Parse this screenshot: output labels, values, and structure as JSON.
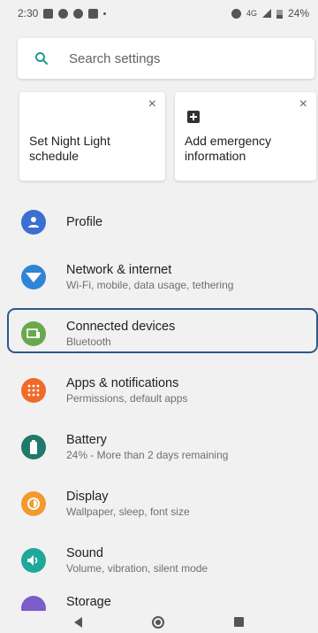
{
  "status_bar": {
    "time": "2:30",
    "network": "4G",
    "battery": "24%"
  },
  "search": {
    "placeholder": "Search settings"
  },
  "suggestions": [
    {
      "label": "Set Night Light schedule",
      "icon": "moon-icon"
    },
    {
      "label": "Add emergency information",
      "icon": "medical-plus-icon"
    }
  ],
  "settings": [
    {
      "title": "Profile",
      "subtitle": "",
      "icon": "person-icon",
      "color": "#3b6fd1"
    },
    {
      "title": "Network & internet",
      "subtitle": "Wi-Fi, mobile, data usage, tethering",
      "icon": "wifi-icon",
      "color": "#2f84d6"
    },
    {
      "title": "Connected devices",
      "subtitle": "Bluetooth",
      "icon": "devices-icon",
      "color": "#6aa84f"
    },
    {
      "title": "Apps & notifications",
      "subtitle": "Permissions, default apps",
      "icon": "apps-icon",
      "color": "#f06a2a"
    },
    {
      "title": "Battery",
      "subtitle": "24% - More than 2 days remaining",
      "icon": "battery-icon",
      "color": "#1f7a6a"
    },
    {
      "title": "Display",
      "subtitle": "Wallpaper, sleep, font size",
      "icon": "brightness-icon",
      "color": "#f29a2e"
    },
    {
      "title": "Sound",
      "subtitle": "Volume, vibration, silent mode",
      "icon": "volume-icon",
      "color": "#1ea89a"
    },
    {
      "title": "Storage",
      "subtitle": "",
      "icon": "storage-icon",
      "color": "#7b5cc9"
    }
  ],
  "nav": {
    "back": "back-icon",
    "home": "home-icon",
    "recents": "recents-icon"
  }
}
